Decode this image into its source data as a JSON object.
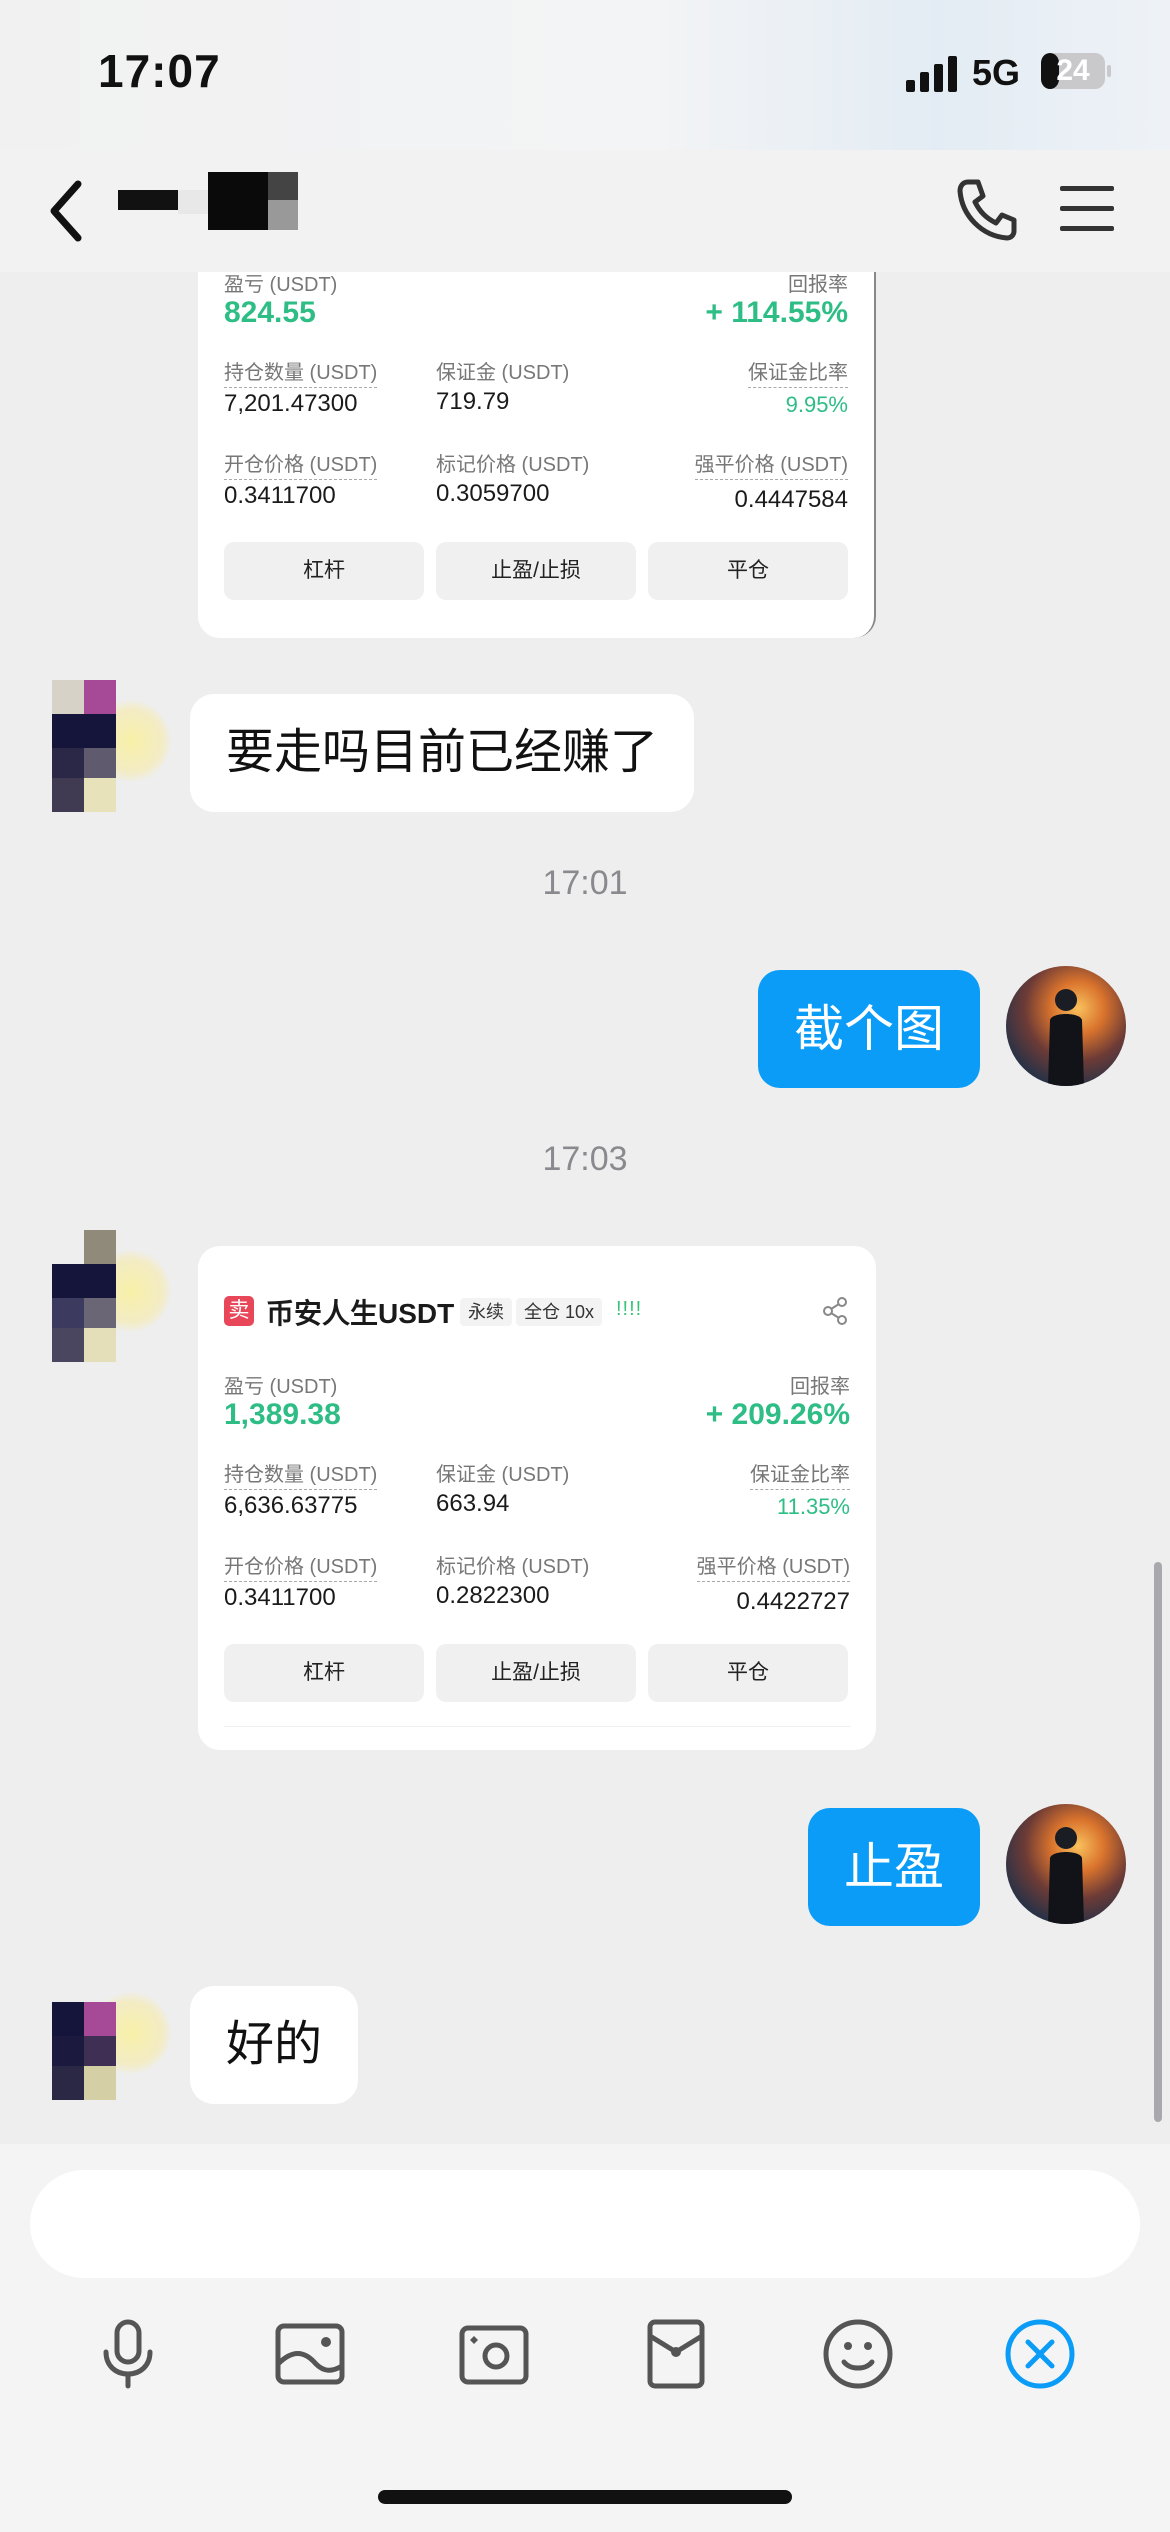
{
  "status_bar": {
    "time": "17:07",
    "network": "5G",
    "battery": "24"
  },
  "header": {
    "contact_name": "",
    "back_icon": "chevron-left-icon",
    "call_icon": "phone-icon",
    "menu_icon": "hamburger-menu-icon"
  },
  "messages": {
    "card1": {
      "pnl_label": "盈亏 (USDT)",
      "pnl_value": "824.55",
      "roe_label": "回报率",
      "roe_value": "+ 114.55%",
      "size_label": "持仓数量 (USDT)",
      "size_value": "7,201.47300",
      "margin_label": "保证金 (USDT)",
      "margin_value": "719.79",
      "margin_ratio_label": "保证金比率",
      "margin_ratio_value": "9.95%",
      "entry_label": "开仓价格 (USDT)",
      "entry_value": "0.3411700",
      "mark_label": "标记价格 (USDT)",
      "mark_value": "0.3059700",
      "liq_label": "强平价格 (USDT)",
      "liq_value": "0.4447584",
      "btn_leverage": "杠杆",
      "btn_tpsl": "止盈/止损",
      "btn_close": "平仓"
    },
    "msg_in_1": "要走吗目前已经赚了",
    "time_1": "17:01",
    "msg_out_1": "截个图",
    "time_2": "17:03",
    "card2": {
      "side_badge": "卖",
      "symbol": "币安人生USDT",
      "tag_perp": "永续",
      "tag_margin": "全仓 10x",
      "bars": "!!!!",
      "pnl_label": "盈亏 (USDT)",
      "pnl_value": "1,389.38",
      "roe_label": "回报率",
      "roe_value": "+ 209.26%",
      "size_label": "持仓数量 (USDT)",
      "size_value": "6,636.63775",
      "margin_label": "保证金 (USDT)",
      "margin_value": "663.94",
      "margin_ratio_label": "保证金比率",
      "margin_ratio_value": "11.35%",
      "entry_label": "开仓价格 (USDT)",
      "entry_value": "0.3411700",
      "mark_label": "标记价格 (USDT)",
      "mark_value": "0.2822300",
      "liq_label": "强平价格 (USDT)",
      "liq_value": "0.4422727",
      "btn_leverage": "杠杆",
      "btn_tpsl": "止盈/止损",
      "btn_close": "平仓"
    },
    "msg_out_2": "止盈",
    "msg_in_2": "好的"
  },
  "input": {
    "placeholder": ""
  },
  "toolbar": {
    "icons": [
      "microphone-icon",
      "image-icon",
      "camera-icon",
      "red-packet-icon",
      "emoji-icon",
      "close-icon"
    ]
  },
  "colors": {
    "accent_blue": "#0a9cf7",
    "profit_green": "#2ebd85",
    "sell_red": "#e8475a"
  }
}
